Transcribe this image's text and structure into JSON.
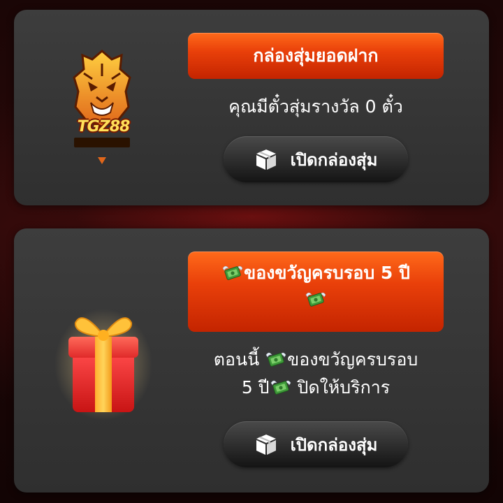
{
  "cards": [
    {
      "banner_title": "กล่องสุ่มยอดฝาก",
      "info_text": "คุณมีตั๋วสุ่มรางวัล 0 ตั๋ว",
      "button_label": "เปิดกล่องสุ่ม",
      "logo_text": "TGZ88"
    },
    {
      "banner_title": "ของขวัญครบรอบ 5 ปี",
      "info_line1_a": "ตอนนี้ ",
      "info_line1_b": "ของขวัญครบรอบ",
      "info_line2_a": "5 ปี",
      "info_line2_b": " ปิดให้บริการ",
      "button_label": "เปิดกล่องสุ่ม"
    }
  ],
  "colors": {
    "banner_orange": "#e9400a",
    "card_bg": "#363636",
    "button_bg": "#1f1f1f",
    "text": "#ffffff"
  },
  "icons": {
    "banner_emoji": "money-with-wings-icon",
    "button_icon": "package-box-icon",
    "card1_image": "tiger-logo-icon",
    "card2_image": "gift-box-icon"
  }
}
